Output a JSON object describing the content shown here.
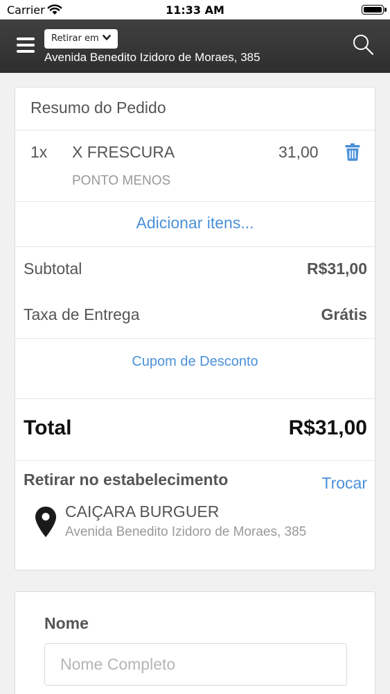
{
  "status_bar": {
    "carrier": "Carrier",
    "time": "11:33 AM"
  },
  "header": {
    "mode_label": "Retirar em",
    "address": "Avenida Benedito Izidoro de Moraes, 385",
    "icons": [
      "menu-icon",
      "chevron-down-icon",
      "search-icon"
    ]
  },
  "summary": {
    "title": "Resumo do Pedido",
    "items": [
      {
        "qty": "1x",
        "name": "X FRESCURA",
        "price": "31,00",
        "option": "PONTO MENOS"
      }
    ],
    "add_items": "Adicionar itens...",
    "subtotal_label": "Subtotal",
    "subtotal_value": "R$31,00",
    "delivery_label": "Taxa de Entrega",
    "delivery_value": "Grátis",
    "coupon": "Cupom de Desconto",
    "total_label": "Total",
    "total_value": "R$31,00"
  },
  "pickup": {
    "title": "Retirar no estabelecimento",
    "change": "Trocar",
    "store_name": "CAIÇARA BURGUER",
    "store_address": "Avenida Benedito Izidoro de Moraes, 385"
  },
  "form": {
    "name_label": "Nome",
    "name_placeholder": "Nome Completo",
    "name_value": ""
  },
  "colors": {
    "accent": "#4a90d9",
    "header": "#3a3a3a"
  }
}
